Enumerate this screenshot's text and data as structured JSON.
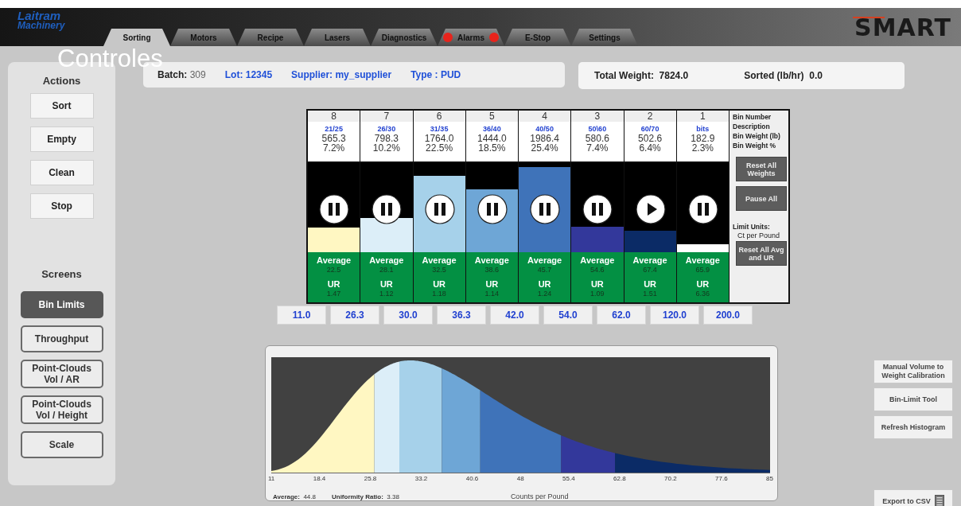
{
  "header": {
    "logo_line1": "Laitram",
    "logo_line2": "Machinery",
    "brand": "SMART"
  },
  "tabs": [
    {
      "label": "Sorting",
      "selected": true,
      "alarm": false
    },
    {
      "label": "Motors",
      "selected": false,
      "alarm": false
    },
    {
      "label": "Recipe",
      "selected": false,
      "alarm": false
    },
    {
      "label": "Lasers",
      "selected": false,
      "alarm": false
    },
    {
      "label": "Diagnostics",
      "selected": false,
      "alarm": false
    },
    {
      "label": "Alarms",
      "selected": false,
      "alarm": true
    },
    {
      "label": "E-Stop",
      "selected": false,
      "alarm": false
    },
    {
      "label": "Settings",
      "selected": false,
      "alarm": false
    }
  ],
  "overlay_caption": "Controles",
  "actions": {
    "title": "Actions",
    "buttons": [
      "Sort",
      "Empty",
      "Clean",
      "Stop"
    ]
  },
  "screens": {
    "title": "Screens",
    "items": [
      {
        "label": "Bin Limits",
        "selected": true
      },
      {
        "label": "Throughput",
        "selected": false
      },
      {
        "label": "Point-Clouds Vol / AR",
        "selected": false
      },
      {
        "label": "Point-Clouds Vol / Height",
        "selected": false
      },
      {
        "label": "Scale",
        "selected": false
      }
    ]
  },
  "info": [
    {
      "label": "Batch:",
      "value": "309",
      "kind": "plain"
    },
    {
      "label": "Lot:",
      "value": "12345",
      "kind": "blue"
    },
    {
      "label": "Supplier:",
      "value": "my_supplier",
      "kind": "blue"
    },
    {
      "label": "Type :",
      "value": "PUD",
      "kind": "blue"
    }
  ],
  "totals": [
    {
      "label": "Total Weight:",
      "value": "7824.0"
    },
    {
      "label": "Sorted (lb/hr)",
      "value": "0.0"
    }
  ],
  "bins": [
    {
      "number": "8",
      "description": "21/25",
      "weight": "565.3",
      "percent": "7.2%",
      "color": "#fff7c2",
      "level": 0.27,
      "paused": false,
      "average_label": "Average",
      "average": "22.5",
      "ur_label": "UR",
      "ur": "1.47"
    },
    {
      "number": "7",
      "description": "26/30",
      "weight": "798.3",
      "percent": "10.2%",
      "color": "#dceef8",
      "level": 0.38,
      "paused": false,
      "average_label": "Average",
      "average": "28.1",
      "ur_label": "UR",
      "ur": "1.12"
    },
    {
      "number": "6",
      "description": "31/35",
      "weight": "1764.0",
      "percent": "22.5%",
      "color": "#a6d1ea",
      "level": 0.84,
      "paused": false,
      "average_label": "Average",
      "average": "32.5",
      "ur_label": "UR",
      "ur": "1.18"
    },
    {
      "number": "5",
      "description": "36/40",
      "weight": "1444.0",
      "percent": "18.5%",
      "color": "#6ea6d6",
      "level": 0.69,
      "paused": false,
      "average_label": "Average",
      "average": "38.6",
      "ur_label": "UR",
      "ur": "1.14"
    },
    {
      "number": "4",
      "description": "40/50",
      "weight": "1986.4",
      "percent": "25.4%",
      "color": "#3f73b9",
      "level": 0.94,
      "paused": false,
      "average_label": "Average",
      "average": "45.7",
      "ur_label": "UR",
      "ur": "1.24"
    },
    {
      "number": "3",
      "description": "50\\60",
      "weight": "580.6",
      "percent": "7.4%",
      "color": "#33389b",
      "level": 0.28,
      "paused": false,
      "average_label": "Average",
      "average": "54.6",
      "ur_label": "UR",
      "ur": "1.09"
    },
    {
      "number": "2",
      "description": "60/70",
      "weight": "502.6",
      "percent": "6.4%",
      "color": "#0b2b66",
      "level": 0.24,
      "paused": true,
      "average_label": "Average",
      "average": "67.4",
      "ur_label": "UR",
      "ur": "1.51"
    },
    {
      "number": "1",
      "description": "bits",
      "weight": "182.9",
      "percent": "2.3%",
      "color": "#ffffff",
      "level": 0.09,
      "paused": false,
      "average_label": "Average",
      "average": "65.9",
      "ur_label": "UR",
      "ur": "6.36"
    }
  ],
  "bin_labels": [
    "Bin Number",
    "Description",
    "Bin Weight (lb)",
    "Bin Weight %"
  ],
  "bin_buttons": {
    "reset_weights": "Reset All Weights",
    "pause_all": "Pause All",
    "reset_avg": "Reset All Avg and UR"
  },
  "limit_units": {
    "label": "Limit Units:",
    "value": "Ct per Pound"
  },
  "limits": [
    "11.0",
    "26.3",
    "30.0",
    "36.3",
    "42.0",
    "54.0",
    "62.0",
    "120.0",
    "200.0"
  ],
  "histogram": {
    "x_ticks": [
      "11",
      "18.4",
      "25.8",
      "33.2",
      "40.6",
      "48",
      "55.4",
      "62.8",
      "70.2",
      "77.6",
      "85"
    ],
    "xlabel": "Counts per Pound",
    "average_label": "Average:",
    "average": "44.8",
    "ratio_label": "Uniformity Ratio:",
    "ratio": "3.38"
  },
  "side_buttons": [
    "Manual Volume to Weight Calibration",
    "Bin-Limit Tool",
    "Refresh Histogram"
  ],
  "export_button": "Export to CSV"
}
